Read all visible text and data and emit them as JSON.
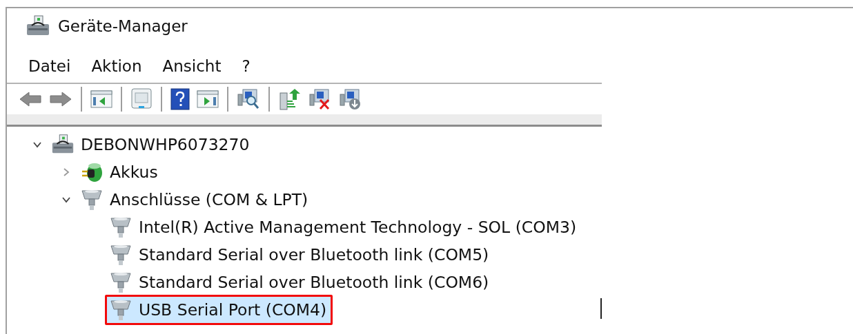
{
  "window": {
    "title": "Geräte-Manager"
  },
  "menu": [
    "Datei",
    "Aktion",
    "Ansicht",
    "?"
  ],
  "toolbar": [
    {
      "kind": "back",
      "disabled": true
    },
    {
      "kind": "forward",
      "disabled": true
    },
    {
      "kind": "separator"
    },
    {
      "kind": "console-tree",
      "disabled": false
    },
    {
      "kind": "separator"
    },
    {
      "kind": "properties",
      "disabled": false
    },
    {
      "kind": "separator"
    },
    {
      "kind": "help",
      "disabled": false
    },
    {
      "kind": "action-pane",
      "disabled": false
    },
    {
      "kind": "separator"
    },
    {
      "kind": "scan",
      "disabled": false
    },
    {
      "kind": "separator"
    },
    {
      "kind": "update-driver",
      "disabled": false
    },
    {
      "kind": "uninstall",
      "disabled": false
    },
    {
      "kind": "disable",
      "disabled": false
    }
  ],
  "tree": [
    {
      "label": "DEBONWHP6073270",
      "kind": "computer",
      "expanded": true,
      "selected": false,
      "highlighted": false,
      "children": [
        {
          "label": "Akkus",
          "kind": "battery",
          "expanded": false,
          "selected": false,
          "highlighted": false
        },
        {
          "label": "Anschlüsse (COM & LPT)",
          "kind": "port",
          "expanded": true,
          "selected": false,
          "highlighted": false,
          "children": [
            {
              "label": "Intel(R) Active Management Technology - SOL (COM3)",
              "kind": "port",
              "selected": false,
              "highlighted": false
            },
            {
              "label": "Standard Serial over Bluetooth link (COM5)",
              "kind": "port",
              "selected": false,
              "highlighted": false
            },
            {
              "label": "Standard Serial over Bluetooth link (COM6)",
              "kind": "port",
              "selected": false,
              "highlighted": false
            },
            {
              "label": "USB Serial Port (COM4)",
              "kind": "port",
              "selected": true,
              "highlighted": true
            }
          ]
        }
      ]
    }
  ]
}
